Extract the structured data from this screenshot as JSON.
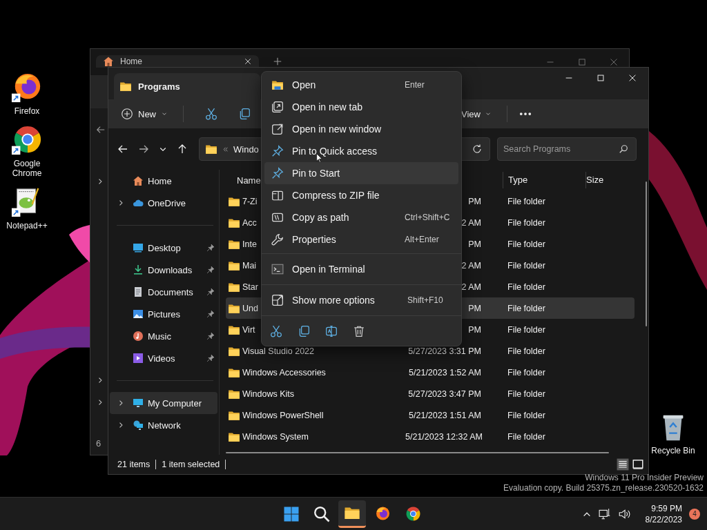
{
  "desktop_icons": [
    {
      "label": "Firefox",
      "kind": "firefox"
    },
    {
      "label": "Google Chrome",
      "kind": "chrome"
    },
    {
      "label": "Notepad++",
      "kind": "notepad"
    },
    {
      "label": "Recycle Bin",
      "kind": "recycle"
    }
  ],
  "background_window": {
    "tab_title": "Home",
    "status_text": "6"
  },
  "window": {
    "title": "Programs",
    "new_label": "New",
    "view_label": "View",
    "address": "Windo",
    "search": {
      "placeholder": "Search Programs"
    },
    "sidebar": {
      "items": [
        {
          "label": "Home",
          "kind": "home",
          "expandable": false,
          "pinned": false,
          "selected": false,
          "divider_before": false
        },
        {
          "label": "OneDrive",
          "kind": "cloud",
          "expandable": true,
          "pinned": false,
          "selected": false,
          "divider_before": false
        },
        {
          "label": "Desktop",
          "kind": "desktop",
          "expandable": false,
          "pinned": true,
          "selected": false,
          "divider_before": true
        },
        {
          "label": "Downloads",
          "kind": "downloads",
          "expandable": false,
          "pinned": true,
          "selected": false,
          "divider_before": false
        },
        {
          "label": "Documents",
          "kind": "documents",
          "expandable": false,
          "pinned": true,
          "selected": false,
          "divider_before": false
        },
        {
          "label": "Pictures",
          "kind": "pictures",
          "expandable": false,
          "pinned": true,
          "selected": false,
          "divider_before": false
        },
        {
          "label": "Music",
          "kind": "music",
          "expandable": false,
          "pinned": true,
          "selected": false,
          "divider_before": false
        },
        {
          "label": "Videos",
          "kind": "videos",
          "expandable": false,
          "pinned": true,
          "selected": false,
          "divider_before": false
        },
        {
          "label": "My Computer",
          "kind": "computer",
          "expandable": true,
          "pinned": false,
          "selected": true,
          "divider_before": true
        },
        {
          "label": "Network",
          "kind": "network",
          "expandable": true,
          "pinned": false,
          "selected": false,
          "divider_before": false
        }
      ]
    },
    "header": {
      "name": "Name",
      "type": "Type",
      "size": "Size"
    },
    "rows": [
      {
        "name": "7-Zi",
        "date": "PM",
        "type": "File folder",
        "selected": false
      },
      {
        "name": "Acc",
        "date": "2 AM",
        "type": "File folder",
        "selected": false
      },
      {
        "name": "Inte",
        "date": "PM",
        "type": "File folder",
        "selected": false
      },
      {
        "name": "Mai",
        "date": "2 AM",
        "type": "File folder",
        "selected": false
      },
      {
        "name": "Star",
        "date": "2 AM",
        "type": "File folder",
        "selected": false
      },
      {
        "name": "Und",
        "date": "PM",
        "type": "File folder",
        "selected": true
      },
      {
        "name": "Virt",
        "date": "PM",
        "type": "File folder",
        "selected": false
      },
      {
        "name": "Visual Studio 2022",
        "date": "5/27/2023 3:31 PM",
        "type": "File folder",
        "selected": false
      },
      {
        "name": "Windows Accessories",
        "date": "5/21/2023 1:52 AM",
        "type": "File folder",
        "selected": false
      },
      {
        "name": "Windows Kits",
        "date": "5/27/2023 3:47 PM",
        "type": "File folder",
        "selected": false
      },
      {
        "name": "Windows PowerShell",
        "date": "5/21/2023 1:51 AM",
        "type": "File folder",
        "selected": false
      },
      {
        "name": "Windows System",
        "date": "5/21/2023 12:32 AM",
        "type": "File folder",
        "selected": false
      }
    ],
    "status": {
      "count": "21 items",
      "selection": "1 item selected"
    }
  },
  "context_menu": {
    "items": [
      {
        "label": "Open",
        "shortcut": "Enter",
        "kind": "open",
        "highlighted": false,
        "divider_before": false
      },
      {
        "label": "Open in new tab",
        "kind": "new-tab",
        "highlighted": false,
        "divider_before": false
      },
      {
        "label": "Open in new window",
        "kind": "new-window",
        "highlighted": false,
        "divider_before": false
      },
      {
        "label": "Pin to Quick access",
        "kind": "pin",
        "highlighted": false,
        "divider_before": false
      },
      {
        "label": "Pin to Start",
        "kind": "pin",
        "highlighted": true,
        "divider_before": false
      },
      {
        "label": "Compress to ZIP file",
        "kind": "zip",
        "highlighted": false,
        "divider_before": false
      },
      {
        "label": "Copy as path",
        "shortcut": "Ctrl+Shift+C",
        "kind": "copy-path",
        "highlighted": false,
        "divider_before": false
      },
      {
        "label": "Properties",
        "shortcut": "Alt+Enter",
        "kind": "properties",
        "highlighted": false,
        "divider_before": false
      },
      {
        "label": "Open in Terminal",
        "kind": "terminal",
        "highlighted": false,
        "divider_before": true
      },
      {
        "label": "Show more options",
        "shortcut": "Shift+F10",
        "kind": "more",
        "highlighted": false,
        "divider_before": true
      }
    ]
  },
  "edition_notice": [
    "Windows 11 Pro Insider Preview",
    "Evaluation copy. Build 25375.zn_release.230520-1632"
  ],
  "taskbar": {
    "apps": [
      {
        "kind": "start",
        "active": false
      },
      {
        "kind": "search",
        "active": false
      },
      {
        "kind": "explorer",
        "active": true
      },
      {
        "kind": "firefox",
        "active": false
      },
      {
        "kind": "chrome",
        "active": false
      }
    ],
    "time": "9:59 PM",
    "date": "8/22/2023",
    "notification_count": "4"
  }
}
